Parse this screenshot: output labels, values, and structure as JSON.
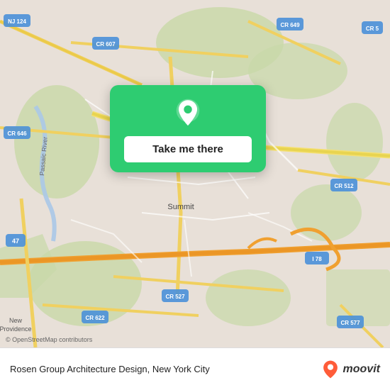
{
  "map": {
    "attribution": "© OpenStreetMap contributors",
    "center_label": "Summit"
  },
  "popup": {
    "button_label": "Take me there"
  },
  "bottom_bar": {
    "location_name": "Rosen Group Architecture Design, New York City"
  },
  "moovit": {
    "brand_name": "moovit"
  },
  "road_labels": [
    "NJ 124",
    "CR 607",
    "CR 649",
    "CR 646",
    "CR 5",
    "Passaic River",
    "CR 512",
    "47",
    "I 78",
    "New Providence",
    "CR 527",
    "CR 622",
    "CR 577"
  ]
}
